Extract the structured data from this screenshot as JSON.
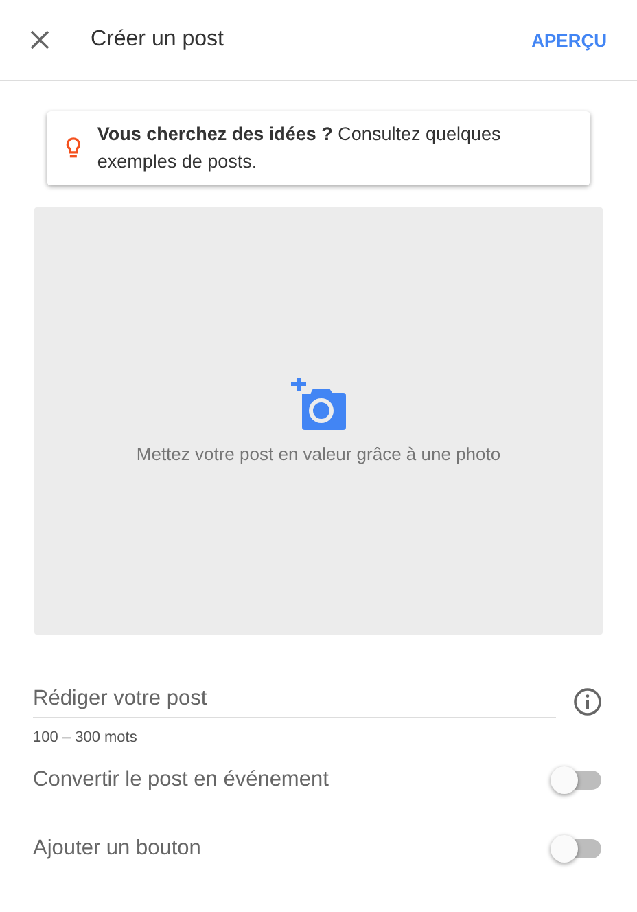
{
  "header": {
    "title": "Créer un post",
    "action": "APERÇU"
  },
  "tip": {
    "text": "**Vous cherchez des idées ?** Consultez quelques exemples de posts."
  },
  "photo": {
    "prompt": "Mettez votre post en valeur grâce à une photo"
  },
  "post_field": {
    "placeholder": "Rédiger votre post",
    "hint": "100 – 300 mots"
  },
  "toggles": [
    {
      "label": "Convertir le post en événement",
      "on": false
    },
    {
      "label": "Ajouter un bouton",
      "on": false
    }
  ]
}
